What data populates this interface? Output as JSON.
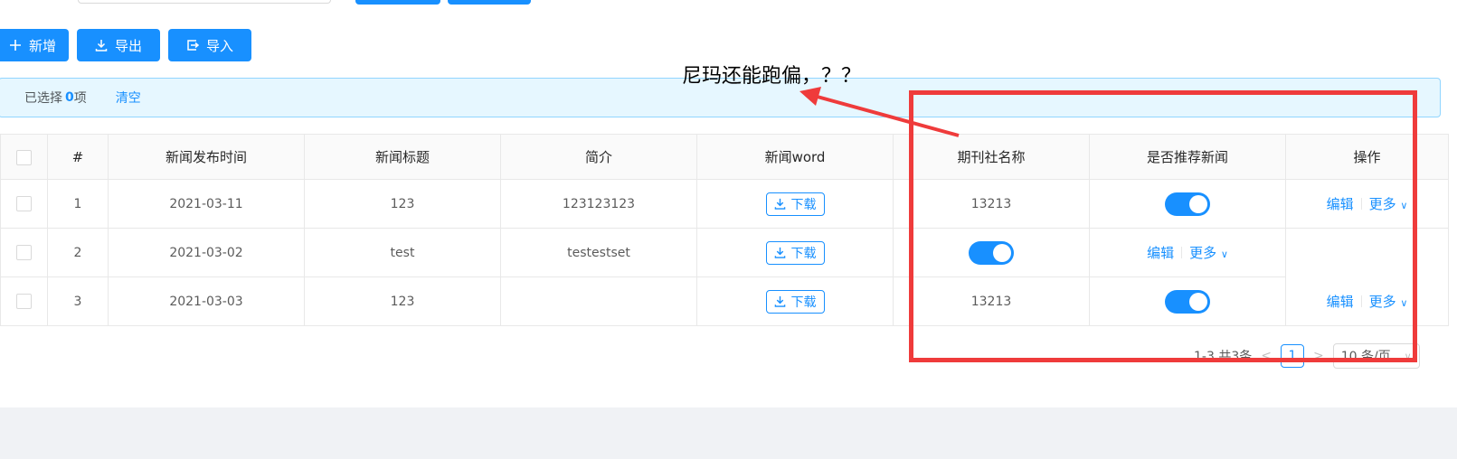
{
  "toolbar": {
    "add_label": "新增",
    "export_label": "导出",
    "import_label": "导入"
  },
  "alert": {
    "prefix": "已选择",
    "count": "0",
    "suffix": "项",
    "clear_label": "清空"
  },
  "table": {
    "headers": [
      "#",
      "新闻发布时间",
      "新闻标题",
      "简介",
      "新闻word",
      "期刊社名称",
      "是否推荐新闻",
      "操作"
    ],
    "rows": [
      {
        "index": "1",
        "date": "2021-03-11",
        "title": "123",
        "intro": "123123123",
        "download": "下载",
        "journal": "13213"
      },
      {
        "index": "2",
        "date": "2021-03-02",
        "title": "test",
        "intro": "testestset",
        "download": "下载",
        "journal": ""
      },
      {
        "index": "3",
        "date": "2021-03-03",
        "title": "123",
        "intro": "",
        "download": "下载",
        "journal": "13213"
      }
    ],
    "edit_label": "编辑",
    "more_label": "更多"
  },
  "pagination": {
    "summary": "1-3 共3条",
    "current_page": "1",
    "page_size": "10 条/页"
  },
  "annotation": {
    "text": "尼玛还能跑偏，？？"
  },
  "colors": {
    "primary": "#1890ff",
    "annotation_red": "#ef3b3b"
  }
}
